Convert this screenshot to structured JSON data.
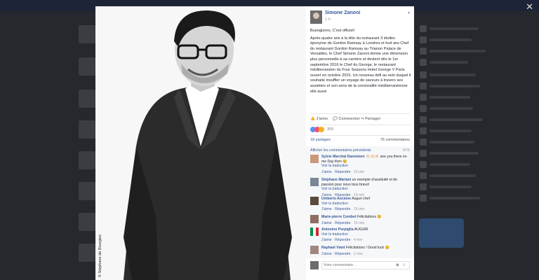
{
  "window": {
    "close_glyph": "✕"
  },
  "photo": {
    "credit": "© Stéphane de Bourgies"
  },
  "post": {
    "author": "Simone Zanoni",
    "time": "1 h",
    "paragraphs": [
      "Buongiorno, C'est officiel!",
      "Après quatre ans à la tête du restaurant 3 étoiles éponyme de Gordon Ramsay à Londres et huit ans Chef du restaurant Gordon Ramsay au Trianon Palace de Versailles, le Chef Simone Zanoni donne une dimension plus personnelle à sa carrière et devient dès le 1er septembre 2016 le Chef du George, le restaurant méditerranéen du Four Seasons Hotel George V Paris ouvert en octobre 2015. Un nouveau défi au sein duquel il souhaite insuffler un voyage de saveurs à travers ses assiettes et son sens de la convivialité méditerranéenne elle aussi"
    ],
    "actions": {
      "like": "J'aime",
      "comment": "Commenter",
      "share": "Partager"
    },
    "reactions_count": "309",
    "shares": "18 partages",
    "comments_count": "76 commentaires"
  },
  "comments": {
    "previous_label": "Afficher les commentaires précédents",
    "previous_count": "6/76",
    "items": [
      {
        "author": "Sylvie Marchal Dannetere",
        "text": "👏🏻👏🏻👏🏻 see you there on me Day then 😊",
        "translate": "Voir la traduction",
        "like": "J'aime",
        "reply": "Répondre",
        "time": "15 min"
      },
      {
        "author": "Stéphane Mariani",
        "text": "un exemple d'assiduité et de passion pour nous tous bravo!",
        "translate": "Voir la traduction",
        "like": "J'aime",
        "reply": "Répondre",
        "time": "15 min"
      },
      {
        "author": "Umberto Ascione",
        "text": "Auguri chef",
        "translate": "Voir la traduction",
        "like": "J'aime",
        "reply": "Répondre",
        "time": "15 min"
      },
      {
        "author": "Marie-pierre Combet",
        "text": "Félicitations 😊",
        "translate": "",
        "like": "J'aime",
        "reply": "Répondre",
        "time": "15 min"
      },
      {
        "author": "Antonino Porpiglia",
        "text": "AUGURI",
        "translate": "Voir la traduction",
        "like": "J'aime",
        "reply": "Répondre",
        "time": "4 min"
      },
      {
        "author": "Raphael Viant",
        "text": "Félicitations ! Good luck 😊",
        "translate": "",
        "like": "J'aime",
        "reply": "Répondre",
        "time": "1 min"
      }
    ]
  },
  "composer": {
    "placeholder": "Votre commentaire..."
  },
  "colors": {
    "link": "#365899",
    "like_blue": "#5890ff",
    "love_red": "#f25268",
    "wow_yellow": "#f7b125"
  },
  "icons": [
    "close-icon",
    "like-icon",
    "comment-icon",
    "share-icon",
    "like-reaction-icon",
    "love-reaction-icon",
    "haha-reaction-icon",
    "camera-icon",
    "emoji-icon",
    "chevron-down-icon"
  ]
}
